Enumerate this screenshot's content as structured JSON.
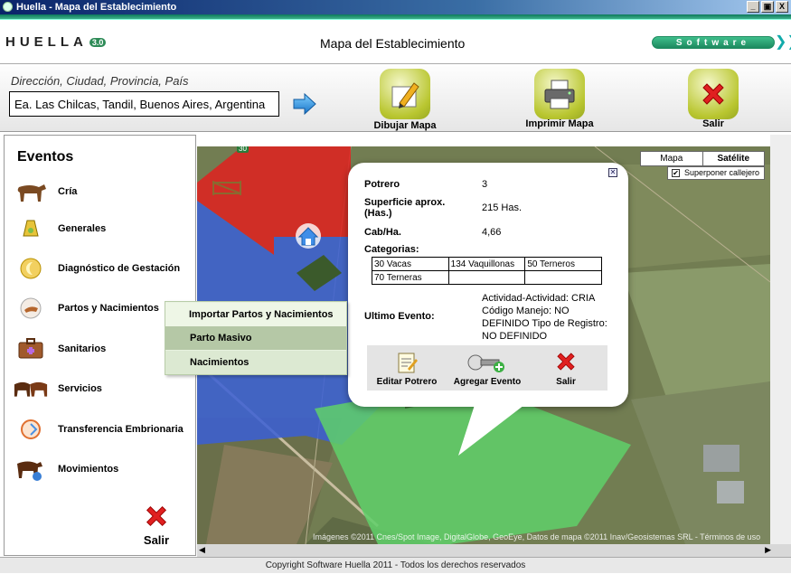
{
  "window": {
    "title": "Huella - Mapa del Establecimiento",
    "controls": [
      "_",
      "▣",
      "X"
    ]
  },
  "header": {
    "logo_text": "HUELLA",
    "logo_version": "3.0",
    "page_title": "Mapa del Establecimiento",
    "software_badge": "Software"
  },
  "toolbar": {
    "address_label": "Dirección, Ciudad, Provincia, País",
    "address_value": "Ea. Las Chilcas, Tandil, Buenos Aires, Argentina",
    "buttons": [
      {
        "label": "Dibujar Mapa",
        "icon": "pencil-icon"
      },
      {
        "label": "Imprimir Mapa",
        "icon": "printer-icon"
      },
      {
        "label": "Salir",
        "icon": "close-icon"
      }
    ]
  },
  "sidebar": {
    "title": "Eventos",
    "items": [
      {
        "label": "Cría",
        "icon": "calf-icon"
      },
      {
        "label": "Generales",
        "icon": "bell-icon"
      },
      {
        "label": "Diagnóstico de Gestación",
        "icon": "moon-icon"
      },
      {
        "label": "Partos y Nacimientos",
        "icon": "cow-head-icon"
      },
      {
        "label": "Sanitarios",
        "icon": "medkit-icon"
      },
      {
        "label": "Servicios",
        "icon": "bulls-icon"
      },
      {
        "label": "Transferencia Embrionaria",
        "icon": "embryo-icon"
      },
      {
        "label": "Movimientos",
        "icon": "cow-move-icon"
      }
    ],
    "exit_label": "Salir"
  },
  "submenu": {
    "items": [
      "Importar Partos y Nacimientos",
      "Parto Masivo",
      "Nacimientos"
    ]
  },
  "map": {
    "type_options": [
      "Mapa",
      "Satélite"
    ],
    "selected_type": "Satélite",
    "overlay_label": "Superponer callejero",
    "overlay_checked": true,
    "road_marker": "30",
    "attribution": "Imágenes ©2011 Cnes/Spot Image, DigitalGlobe, GeoEye, Datos de mapa ©2011 Inav/Geosistemas SRL - Términos de uso"
  },
  "popup": {
    "potrero_label": "Potrero",
    "potrero_value": "3",
    "superficie_label": "Superficie aprox. (Has.)",
    "superficie_value": "215 Has.",
    "cab_label": "Cab/Ha.",
    "cab_value": "4,66",
    "categorias_label": "Categorias:",
    "categorias": [
      [
        "30 Vacas",
        "134 Vaquillonas",
        "50 Terneros"
      ],
      [
        "70 Terneras",
        "",
        ""
      ]
    ],
    "ultimo_label": "Ultimo Evento:",
    "ultimo_value": "Actividad-Actividad: CRIA Código Manejo: NO DEFINIDO Tipo de Registro: NO DEFINIDO",
    "actions": [
      {
        "label": "Editar Potrero",
        "icon": "notepad-icon"
      },
      {
        "label": "Agregar Evento",
        "icon": "add-event-icon"
      },
      {
        "label": "Salir",
        "icon": "close-icon"
      }
    ]
  },
  "status": {
    "copyright": "Copyright Software Huella 2011 - Todos los derechos reservados"
  },
  "colors": {
    "brand_green": "#1d8a5f",
    "paddock_red": "#e0201e",
    "paddock_blue": "#3a5fd6",
    "paddock_green": "#5fd06a"
  }
}
